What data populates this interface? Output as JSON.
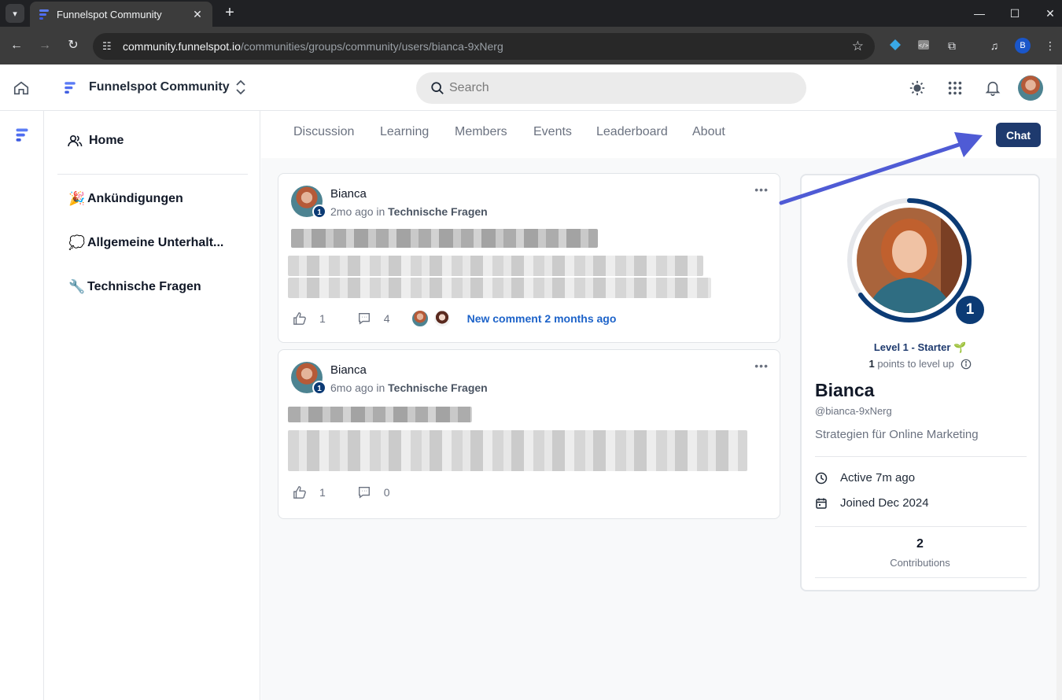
{
  "browser": {
    "tab_title": "Funnelspot Community",
    "url_host": "community.funnelspot.io",
    "url_path": "/communities/groups/community/users/bianca-9xNerg",
    "profile_initial": "B"
  },
  "header": {
    "brand_name": "Funnelspot Community",
    "search_placeholder": "Search"
  },
  "sidebar": {
    "home_label": "Home",
    "channels": [
      {
        "emoji": "🎉",
        "label": "Ankündigungen"
      },
      {
        "emoji": "💭",
        "label": "Allgemeine Unterhalt..."
      },
      {
        "emoji": "🔧",
        "label": "Technische Fragen"
      }
    ]
  },
  "tabs": [
    "Discussion",
    "Learning",
    "Members",
    "Events",
    "Leaderboard",
    "About"
  ],
  "chat_label": "Chat",
  "posts": [
    {
      "author": "Bianca",
      "level": "1",
      "time": "2mo ago",
      "in": "in",
      "category": "Technische Fragen",
      "likes": "1",
      "comments": "4",
      "new_comment": "New comment 2 months ago"
    },
    {
      "author": "Bianca",
      "level": "1",
      "time": "6mo ago",
      "in": "in",
      "category": "Technische Fragen",
      "likes": "1",
      "comments": "0"
    }
  ],
  "profile": {
    "level_badge": "1",
    "level_text": "Level 1 - Starter 🌱",
    "points_value": "1",
    "points_suffix": " points to level up",
    "name": "Bianca",
    "handle": "@bianca-9xNerg",
    "bio": "Strategien für Online Marketing",
    "active": "Active 7m ago",
    "joined": "Joined Dec 2024",
    "contributions_count": "2",
    "contributions_label": "Contributions"
  },
  "colors": {
    "accent": "#1e3a6e",
    "level_badge": "#0c3b75",
    "link": "#1d63c9",
    "annotation_arrow": "#4f5bd5"
  }
}
